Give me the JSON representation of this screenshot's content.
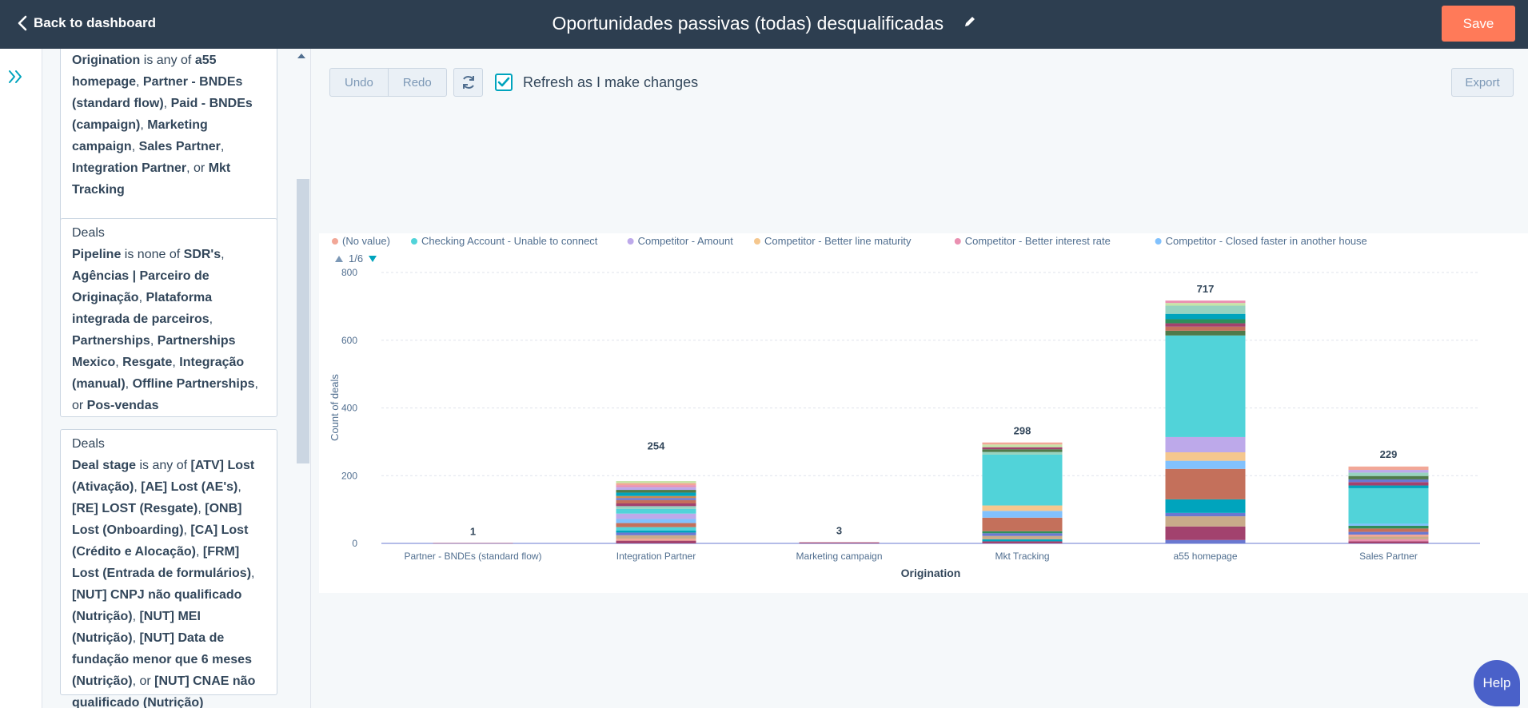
{
  "header": {
    "back_label": "Back to dashboard",
    "title": "Oportunidades passivas (todas) desqualificadas",
    "save_label": "Save"
  },
  "toolbar": {
    "undo_label": "Undo",
    "redo_label": "Redo",
    "refresh_checkbox_label": "Refresh as I make changes",
    "refresh_checked": true,
    "export_label": "Export"
  },
  "filters": [
    {
      "parts": [
        {
          "t": "Origination",
          "b": true
        },
        {
          "t": " is any of ",
          "b": false
        },
        {
          "t": "a55 homepage",
          "b": true
        },
        {
          "t": ", ",
          "b": false
        },
        {
          "t": "Partner - BNDEs (standard flow)",
          "b": true
        },
        {
          "t": ", ",
          "b": false
        },
        {
          "t": "Paid - BNDEs (campaign)",
          "b": true
        },
        {
          "t": ", ",
          "b": false
        },
        {
          "t": "Marketing campaign",
          "b": true
        },
        {
          "t": ", ",
          "b": false
        },
        {
          "t": "Sales Partner",
          "b": true
        },
        {
          "t": ", ",
          "b": false
        },
        {
          "t": "Integration Partner",
          "b": true
        },
        {
          "t": ", or ",
          "b": false
        },
        {
          "t": "Mkt Tracking",
          "b": true
        }
      ]
    },
    {
      "object": "Deals",
      "parts": [
        {
          "t": "Pipeline",
          "b": true
        },
        {
          "t": " is none of ",
          "b": false
        },
        {
          "t": "SDR's",
          "b": true
        },
        {
          "t": ", ",
          "b": false
        },
        {
          "t": "Agências | Parceiro de Originação",
          "b": true
        },
        {
          "t": ", ",
          "b": false
        },
        {
          "t": "Plataforma integrada de parceiros",
          "b": true
        },
        {
          "t": ", ",
          "b": false
        },
        {
          "t": "Partnerships",
          "b": true
        },
        {
          "t": ", ",
          "b": false
        },
        {
          "t": "Partnerships Mexico",
          "b": true
        },
        {
          "t": ", ",
          "b": false
        },
        {
          "t": "Resgate",
          "b": true
        },
        {
          "t": ", ",
          "b": false
        },
        {
          "t": "Integração (manual)",
          "b": true
        },
        {
          "t": ", ",
          "b": false
        },
        {
          "t": "Offline Partnerships",
          "b": true
        },
        {
          "t": ", or ",
          "b": false
        },
        {
          "t": "Pos-vendas",
          "b": true
        }
      ]
    },
    {
      "object": "Deals",
      "parts": [
        {
          "t": "Deal stage",
          "b": true
        },
        {
          "t": " is any of ",
          "b": false
        },
        {
          "t": "[ATV] Lost (Ativação)",
          "b": true
        },
        {
          "t": ", ",
          "b": false
        },
        {
          "t": "[AE] Lost (AE's)",
          "b": true
        },
        {
          "t": ", ",
          "b": false
        },
        {
          "t": "[RE] LOST (Resgate)",
          "b": true
        },
        {
          "t": ", ",
          "b": false
        },
        {
          "t": "[ONB] Lost (Onboarding)",
          "b": true
        },
        {
          "t": ", ",
          "b": false
        },
        {
          "t": "[CA] Lost (Crédito e Alocação)",
          "b": true
        },
        {
          "t": ", ",
          "b": false
        },
        {
          "t": "[FRM] Lost (Entrada de formulários)",
          "b": true
        },
        {
          "t": ", ",
          "b": false
        },
        {
          "t": "[NUT] CNPJ não qualificado (Nutrição)",
          "b": true
        },
        {
          "t": ", ",
          "b": false
        },
        {
          "t": "[NUT] MEI (Nutrição)",
          "b": true
        },
        {
          "t": ", ",
          "b": false
        },
        {
          "t": "[NUT] Data de fundação menor que 6 meses (Nutrição)",
          "b": true
        },
        {
          "t": ", or ",
          "b": false
        },
        {
          "t": "[NUT] CNAE não qualificado (Nutrição)",
          "b": true
        }
      ]
    }
  ],
  "help_label": "Help",
  "legend_pager": "1/6",
  "chart_data": {
    "type": "bar",
    "stacked": true,
    "xlabel": "Origination",
    "ylabel": "Count of deals",
    "ylim": [
      0,
      800
    ],
    "yticks": [
      0,
      200,
      400,
      600,
      800
    ],
    "grid": true,
    "legend_position": "top",
    "categories": [
      "Partner - BNDEs (standard flow)",
      "Integration Partner",
      "Marketing campaign",
      "Mkt Tracking",
      "a55 homepage",
      "Sales Partner"
    ],
    "totals": [
      1,
      254,
      3,
      298,
      717,
      229
    ],
    "legend": [
      {
        "name": "(No value)",
        "color": "#f2a797"
      },
      {
        "name": "Checking Account - Unable to connect",
        "color": "#51d3d9"
      },
      {
        "name": "Competitor - Amount",
        "color": "#bda9ea"
      },
      {
        "name": "Competitor - Better line maturity",
        "color": "#f5c78e"
      },
      {
        "name": "Competitor - Better interest rate",
        "color": "#ea90b1"
      },
      {
        "name": "Competitor - Closed faster in another house",
        "color": "#81c1fd"
      }
    ],
    "stack_segments": [
      [
        {
          "v": 1,
          "c": "#a2426e"
        }
      ],
      [
        {
          "v": 8,
          "c": "#a2426e"
        },
        {
          "v": 6,
          "c": "#f2a797"
        },
        {
          "v": 10,
          "c": "#c9ab8a"
        },
        {
          "v": 8,
          "c": "#6a78d1"
        },
        {
          "v": 6,
          "c": "#00a4bd"
        },
        {
          "v": 10,
          "c": "#51d3d9"
        },
        {
          "v": 12,
          "c": "#c4705b"
        },
        {
          "v": 12,
          "c": "#81c1fd"
        },
        {
          "v": 16,
          "c": "#bda9ea"
        },
        {
          "v": 14,
          "c": "#51d3d9"
        },
        {
          "v": 8,
          "c": "#97d3c0"
        },
        {
          "v": 8,
          "c": "#a2426e"
        },
        {
          "v": 10,
          "c": "#c4705b"
        },
        {
          "v": 6,
          "c": "#6a78d1"
        },
        {
          "v": 6,
          "c": "#cb8a52"
        },
        {
          "v": 10,
          "c": "#00a4bd"
        },
        {
          "v": 8,
          "c": "#4f7a4a"
        },
        {
          "v": 8,
          "c": "#bda9ea"
        },
        {
          "v": 6,
          "c": "#ea90b1"
        },
        {
          "v": 6,
          "c": "#f2a797"
        },
        {
          "v": 6,
          "c": "#c8e4a8"
        }
      ],
      [
        {
          "v": 3,
          "c": "#a2426e"
        }
      ],
      [
        {
          "v": 6,
          "c": "#a2426e"
        },
        {
          "v": 6,
          "c": "#00a4bd"
        },
        {
          "v": 10,
          "c": "#c9ab8a"
        },
        {
          "v": 8,
          "c": "#6a78d1"
        },
        {
          "v": 6,
          "c": "#2f8f5b"
        },
        {
          "v": 40,
          "c": "#c4705b"
        },
        {
          "v": 20,
          "c": "#81c1fd"
        },
        {
          "v": 16,
          "c": "#f5c78e"
        },
        {
          "v": 150,
          "c": "#51d3d9"
        },
        {
          "v": 8,
          "c": "#97d3c0"
        },
        {
          "v": 8,
          "c": "#4f7a4a"
        },
        {
          "v": 6,
          "c": "#a2426e"
        },
        {
          "v": 8,
          "c": "#c8e4a8"
        },
        {
          "v": 6,
          "c": "#f2a797"
        }
      ],
      [
        {
          "v": 10,
          "c": "#6a78d1"
        },
        {
          "v": 40,
          "c": "#a2426e"
        },
        {
          "v": 30,
          "c": "#c9ab8a"
        },
        {
          "v": 10,
          "c": "#6a78d1"
        },
        {
          "v": 40,
          "c": "#00a4bd"
        },
        {
          "v": 90,
          "c": "#c4705b"
        },
        {
          "v": 24,
          "c": "#81c1fd"
        },
        {
          "v": 25,
          "c": "#f5c78e"
        },
        {
          "v": 45,
          "c": "#bda9ea"
        },
        {
          "v": 300,
          "c": "#51d3d9"
        },
        {
          "v": 14,
          "c": "#4f7a4a"
        },
        {
          "v": 12,
          "c": "#c4705b"
        },
        {
          "v": 10,
          "c": "#a2426e"
        },
        {
          "v": 12,
          "c": "#2f8f5b"
        },
        {
          "v": 16,
          "c": "#00a4bd"
        },
        {
          "v": 24,
          "c": "#97d3c0"
        },
        {
          "v": 8,
          "c": "#c8e4a8"
        },
        {
          "v": 7,
          "c": "#ea90b1"
        }
      ],
      [
        {
          "v": 6,
          "c": "#a2426e"
        },
        {
          "v": 6,
          "c": "#ea90b1"
        },
        {
          "v": 8,
          "c": "#c9ab8a"
        },
        {
          "v": 6,
          "c": "#f2a797"
        },
        {
          "v": 8,
          "c": "#6a78d1"
        },
        {
          "v": 10,
          "c": "#c4705b"
        },
        {
          "v": 8,
          "c": "#2f8f5b"
        },
        {
          "v": 6,
          "c": "#81c1fd"
        },
        {
          "v": 105,
          "c": "#51d3d9"
        },
        {
          "v": 8,
          "c": "#00a4bd"
        },
        {
          "v": 10,
          "c": "#a2426e"
        },
        {
          "v": 8,
          "c": "#6a78d1"
        },
        {
          "v": 10,
          "c": "#4f7a4a"
        },
        {
          "v": 10,
          "c": "#97d3c0"
        },
        {
          "v": 8,
          "c": "#bda9ea"
        },
        {
          "v": 10,
          "c": "#f2a797"
        }
      ]
    ]
  }
}
